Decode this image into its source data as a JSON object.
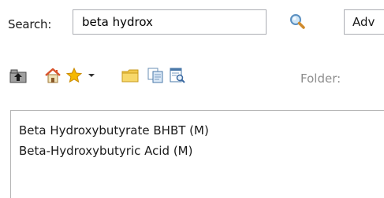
{
  "search": {
    "label": "Search:",
    "value": "beta hydrox",
    "button_icon": "magnifier-icon",
    "advanced_label": "Adv"
  },
  "toolbar": {
    "buttons": [
      {
        "icon": "up-folder-icon"
      },
      {
        "icon": "home-icon"
      },
      {
        "icon": "favorites-star-icon"
      },
      {
        "icon": "dropdown-arrow-icon"
      },
      {
        "icon": "folder-icon"
      },
      {
        "icon": "copy-icon"
      },
      {
        "icon": "search-document-icon"
      }
    ],
    "folder_label": "Folder:"
  },
  "results": {
    "items": [
      "Beta Hydroxybutyrate BHBT (M)",
      "Beta-Hydroxybutyric Acid (M)"
    ]
  },
  "colors": {
    "input_border": "#abadb3",
    "folder_label": "#8c8c8c",
    "star": "#f5b800",
    "folder": "#f2c94c",
    "home_roof": "#d9532c"
  }
}
